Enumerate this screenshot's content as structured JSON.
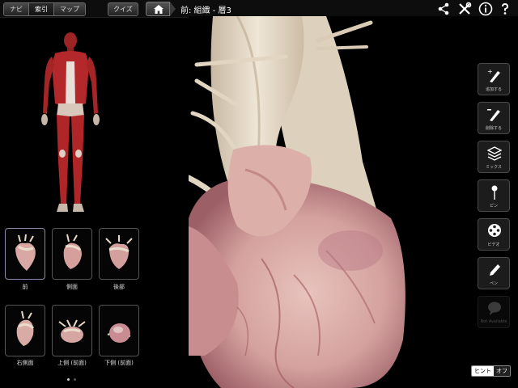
{
  "nav": {
    "tabs": [
      "ナビ",
      "索引",
      "マップ"
    ],
    "active_tab": "索引",
    "quiz_label": "クイズ"
  },
  "breadcrumb": {
    "title": "前: 組織 - 層3"
  },
  "top_icons": [
    "share-icon",
    "tools-icon",
    "info-icon",
    "help-icon"
  ],
  "views": [
    {
      "label": "前",
      "selected": true
    },
    {
      "label": "側面",
      "selected": false
    },
    {
      "label": "後部",
      "selected": false
    },
    {
      "label": "右側面",
      "selected": false
    },
    {
      "label": "上側 (前面)",
      "selected": false
    },
    {
      "label": "下側 (前面)",
      "selected": false
    }
  ],
  "pager": {
    "pages": 2,
    "current": 1
  },
  "tools": [
    {
      "label": "追加する",
      "icon": "add-scalpel-icon"
    },
    {
      "label": "削除する",
      "icon": "remove-scalpel-icon"
    },
    {
      "label": "ミックス",
      "icon": "layers-icon"
    },
    {
      "label": "ピン",
      "icon": "pin-icon"
    },
    {
      "label": "ビデオ",
      "icon": "video-icon"
    },
    {
      "label": "ペン",
      "icon": "pen-icon"
    },
    {
      "label": "Not Available",
      "icon": "comment-icon"
    }
  ],
  "hint": {
    "label": "ヒント",
    "state": "オフ"
  },
  "colors": {
    "heart": "#d9a8a4",
    "vessel": "#e8dccb",
    "muscle": "#b3282a",
    "background": "#000000"
  }
}
